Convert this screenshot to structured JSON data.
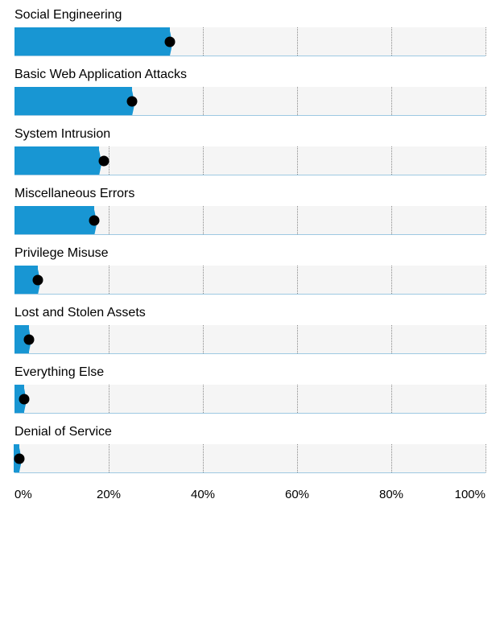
{
  "chart_data": {
    "type": "bar",
    "title": "",
    "xlabel": "",
    "ylabel": "",
    "xlim": [
      0,
      100
    ],
    "ticks": [
      0,
      20,
      40,
      60,
      80,
      100
    ],
    "tick_labels": [
      "0%",
      "20%",
      "40%",
      "60%",
      "80%",
      "100%"
    ],
    "categories": [
      "Social Engineering",
      "Basic Web Application Attacks",
      "System Intrusion",
      "Miscellaneous Errors",
      "Privilege Misuse",
      "Lost and Stolen Assets",
      "Everything Else",
      "Denial of Service"
    ],
    "series": [
      {
        "name": "bar",
        "values": [
          33,
          25,
          18,
          17,
          5,
          3,
          2,
          1
        ]
      },
      {
        "name": "dot",
        "values": [
          33,
          25,
          19,
          17,
          5,
          3,
          2,
          1
        ]
      }
    ]
  }
}
